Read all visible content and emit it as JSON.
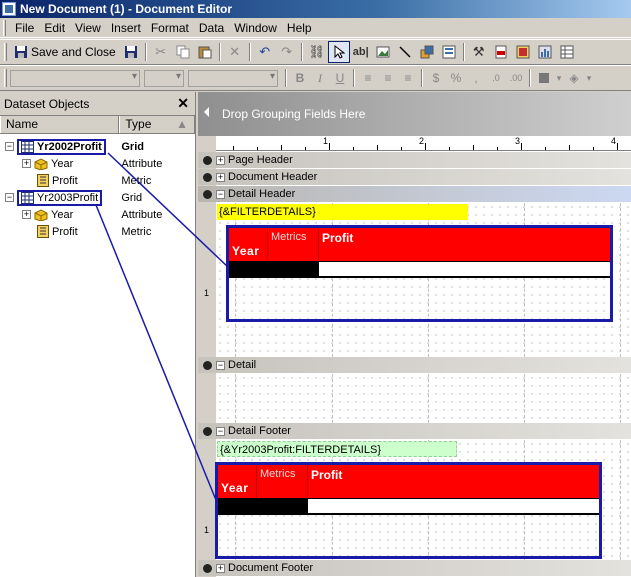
{
  "window": {
    "title": "New Document (1) - Document Editor"
  },
  "menubar": {
    "items": [
      "File",
      "Edit",
      "View",
      "Insert",
      "Format",
      "Data",
      "Window",
      "Help"
    ]
  },
  "toolbar": {
    "save_close_label": "Save and Close"
  },
  "dataset_panel": {
    "title": "Dataset Objects",
    "col_name": "Name",
    "col_type": "Type",
    "rows": [
      {
        "name": "Yr2002Profit",
        "type": "Grid",
        "expander": "−"
      },
      {
        "name": "Year",
        "type": "Attribute",
        "expander": "+"
      },
      {
        "name": "Profit",
        "type": "Metric"
      },
      {
        "name": "Yr2003Profit",
        "type": "Grid",
        "expander": "−"
      },
      {
        "name": "Year",
        "type": "Attribute",
        "expander": "+"
      },
      {
        "name": "Profit",
        "type": "Metric"
      }
    ]
  },
  "editor": {
    "grouping_prompt": "Drop Grouping Fields Here",
    "ruler_numbers": [
      "1",
      "2",
      "3",
      "4"
    ],
    "section_marker": "1",
    "sections": {
      "page_header": "Page Header",
      "document_header": "Document Header",
      "detail_header": "Detail Header",
      "detail": "Detail",
      "detail_footer": "Detail Footer",
      "document_footer": "Document Footer"
    },
    "section_expanders": {
      "collapsed": "+",
      "expanded": "−"
    },
    "fields": {
      "filter_details": "{&FILTERDETAILS}",
      "yr2003_filter_details": "{&Yr2003Profit:FILTERDETAILS}"
    },
    "grid1": {
      "metrics": "Metrics",
      "profit": "Profit",
      "year": "Year"
    },
    "grid2": {
      "metrics": "Metrics",
      "profit": "Profit",
      "year": "Year"
    }
  },
  "colors": {
    "grid_header": "#ff0000",
    "highlight": "#1a1aa8",
    "filter_field": "#ffff00",
    "filter_field2": "#ccffcc"
  }
}
